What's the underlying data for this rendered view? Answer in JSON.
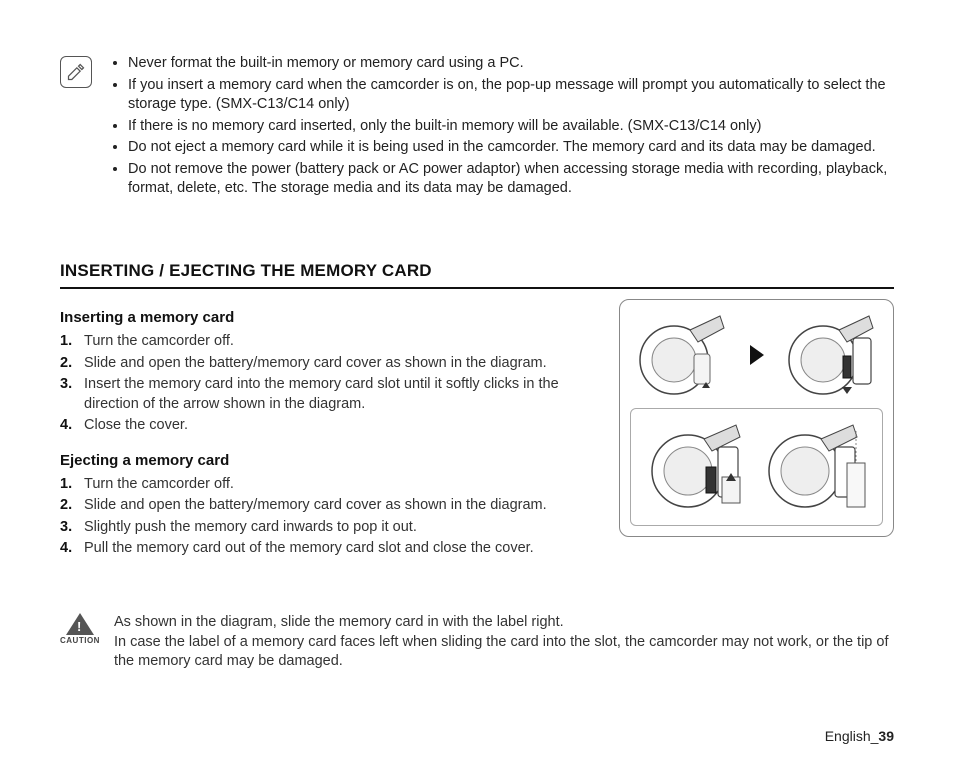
{
  "note_bullets": [
    "Never format the built-in memory or memory card using a PC.",
    "If you insert a memory card when the camcorder is on, the pop-up message will prompt you automatically to select the storage type. (SMX-C13/C14 only)",
    "If there is no memory card inserted, only the built-in memory will be available. (SMX-C13/C14 only)",
    "Do not eject a memory card while it is being used in the camcorder. The memory card and its data may be damaged.",
    "Do not remove the power (battery pack or AC power adaptor) when accessing storage media with recording, playback, format, delete, etc. The storage media and its data may be damaged."
  ],
  "section_heading": "INSERTING / EJECTING THE MEMORY CARD",
  "insert": {
    "heading": "Inserting a memory card",
    "steps": [
      "Turn the camcorder off.",
      "Slide and open the battery/memory card cover as shown in the diagram.",
      "Insert the memory card into the memory card slot until it softly clicks in the direction of the arrow shown in the diagram.",
      "Close the cover."
    ]
  },
  "eject": {
    "heading": "Ejecting a memory card",
    "steps": [
      "Turn the camcorder off.",
      "Slide and open the battery/memory card cover as shown in the diagram.",
      "Slightly push the memory card inwards to pop it out.",
      "Pull the memory card out of the memory card slot and close the cover."
    ]
  },
  "caution": {
    "label": "CAUTION",
    "line1": "As shown in the diagram, slide the memory card in with the label right.",
    "line2": "In case the label of a memory card faces left when sliding the card into the slot, the camcorder may not work, or the tip of the memory card may be damaged."
  },
  "footer": {
    "lang": "English",
    "sep": "_",
    "page": "39"
  }
}
